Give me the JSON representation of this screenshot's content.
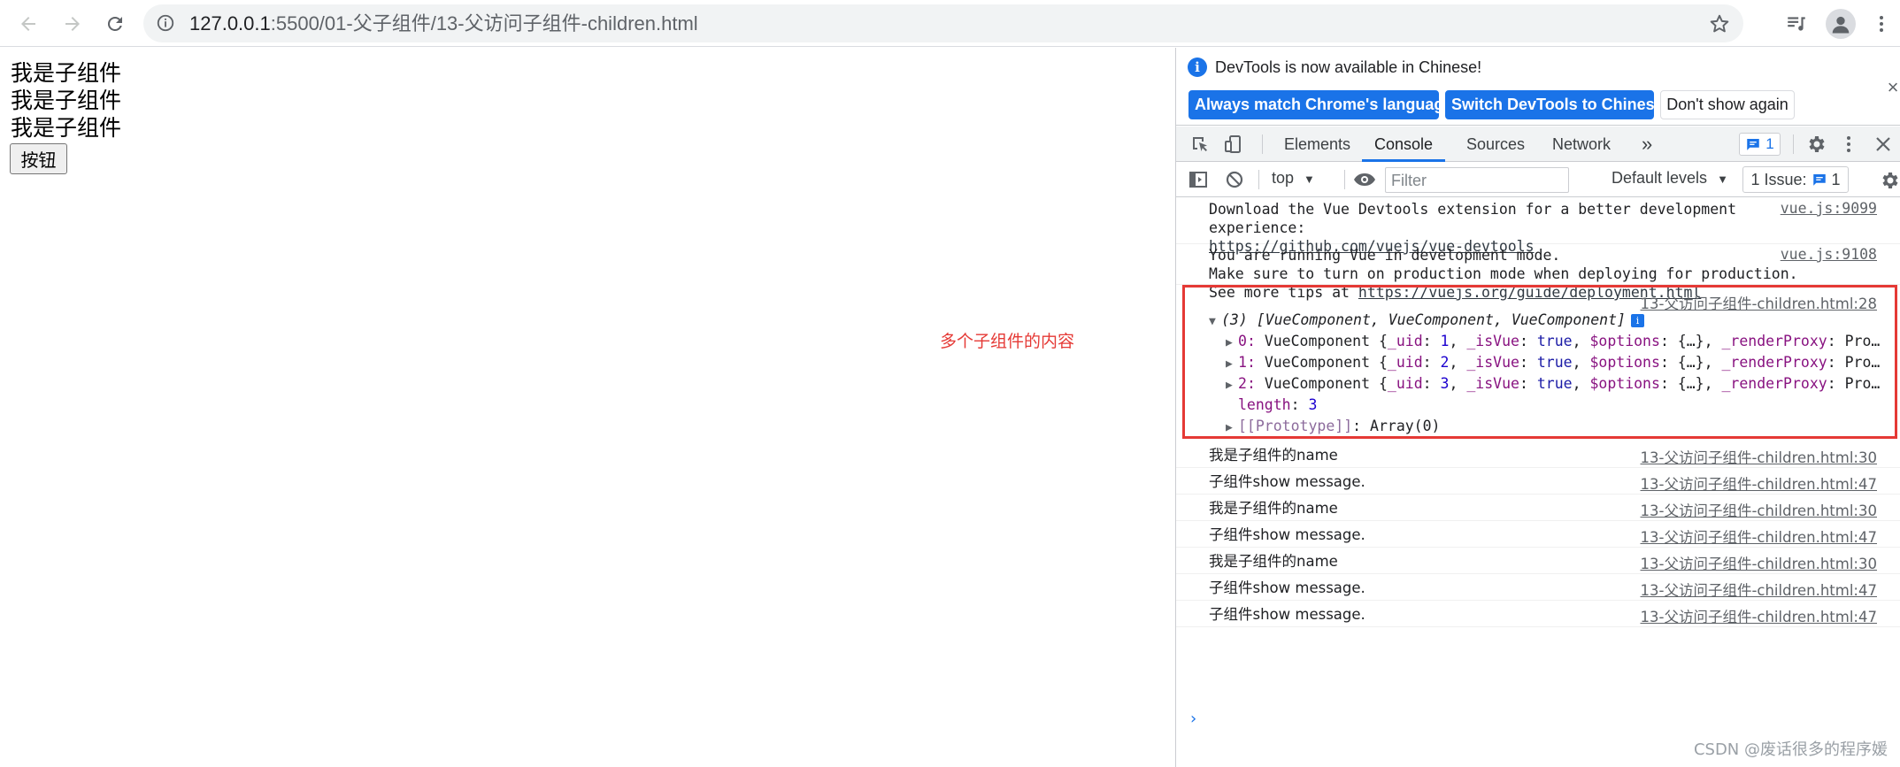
{
  "browser": {
    "url_host": "127.0.0.1",
    "url_path": ":5500/01-父子组件/13-父访问子组件-children.html"
  },
  "page": {
    "child_lines": [
      "我是子组件",
      "我是子组件",
      "我是子组件"
    ],
    "button_label": "按钮",
    "annotation": "多个子组件的内容"
  },
  "devtools": {
    "infobar": {
      "message": "DevTools is now available in Chinese!",
      "btn_match": "Always match Chrome's language",
      "btn_switch": "Switch DevTools to Chinese",
      "btn_dismiss": "Don't show again",
      "close": "×"
    },
    "tabs": [
      "Elements",
      "Console",
      "Sources",
      "Network"
    ],
    "more_tabs": "»",
    "message_count": "1",
    "console_bar": {
      "context": "top",
      "filter_placeholder": "Filter",
      "levels": "Default levels",
      "issues_label": "1 Issue:",
      "issues_count": "1"
    }
  },
  "console": {
    "vue_msg1": {
      "line1": "Download the Vue Devtools extension for a better development",
      "line2": "experience:",
      "link": "https://github.com/vuejs/vue-devtools",
      "source": "vue.js:9099"
    },
    "vue_msg2": {
      "line1": "You are running Vue in development mode.",
      "line2": "Make sure to turn on production mode when deploying for production.",
      "line3_prefix": "See more tips at ",
      "link": "https://vuejs.org/guide/deployment.html",
      "source": "vue.js:9108"
    },
    "array_log": {
      "source": "13-父访问子组件-children.html:28",
      "summary": "(3) [VueComponent, VueComponent, VueComponent]",
      "items": [
        {
          "index": "0",
          "uid": "1"
        },
        {
          "index": "1",
          "uid": "2"
        },
        {
          "index": "2",
          "uid": "3"
        }
      ],
      "item_label": "VueComponent",
      "length_label": "length",
      "length_value": "3",
      "prototype_label": "[[Prototype]]",
      "prototype_value": "Array(0)"
    },
    "logs": [
      {
        "text": "我是子组件的name",
        "source": "13-父访问子组件-children.html:30"
      },
      {
        "text": "子组件show message.",
        "source": "13-父访问子组件-children.html:47"
      },
      {
        "text": "我是子组件的name",
        "source": "13-父访问子组件-children.html:30"
      },
      {
        "text": "子组件show message.",
        "source": "13-父访问子组件-children.html:47"
      },
      {
        "text": "我是子组件的name",
        "source": "13-父访问子组件-children.html:30"
      },
      {
        "text": "子组件show message.",
        "source": "13-父访问子组件-children.html:47"
      },
      {
        "text": "子组件show message.",
        "source": "13-父访问子组件-children.html:47"
      }
    ],
    "prompt": "›"
  },
  "watermark": "CSDN @废话很多的程序媛",
  "colors": {
    "accent": "#1a73e8",
    "highlight": "#e53935"
  }
}
